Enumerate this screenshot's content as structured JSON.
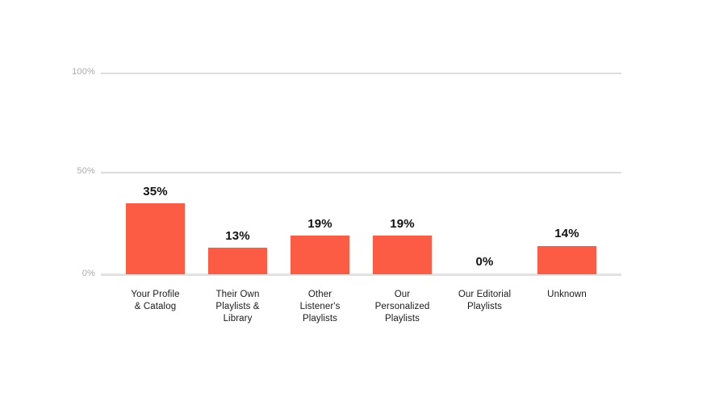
{
  "chart_data": {
    "type": "bar",
    "title": "",
    "subtitle": "",
    "xlabel": "",
    "ylabel": "",
    "categories": [
      "Your Profile\n& Catalog",
      "Their Own\nPlaylists &\nLibrary",
      "Other\nListener's\nPlaylists",
      "Our\nPersonalized\nPlaylists",
      "Our Editorial\nPlaylists",
      "Unknown"
    ],
    "values": [
      35,
      13,
      19,
      19,
      0,
      14
    ],
    "value_labels": [
      "35%",
      "13%",
      "19%",
      "19%",
      "0%",
      "14%"
    ],
    "ylim": [
      0,
      100
    ],
    "yticks": [
      0,
      50,
      100
    ],
    "ytick_labels": [
      "0%",
      "50%",
      "100%"
    ],
    "grid": true,
    "legend": false,
    "legend_position": "none",
    "bar_color": "#fc5c44",
    "gridline_color": "#dcdcdc",
    "axis_label_color": "#aaaaaa",
    "value_label_color": "#111111",
    "background_color": "#ffffff"
  },
  "axis": {
    "y": {
      "tick_0": "0%",
      "tick_50": "50%",
      "tick_100": "100%"
    }
  },
  "bars": [
    {
      "label_line1": "Your Profile",
      "label_line2": "& Catalog",
      "label_line3": "",
      "value": "35%"
    },
    {
      "label_line1": "Their Own",
      "label_line2": "Playlists &",
      "label_line3": "Library",
      "value": "13%"
    },
    {
      "label_line1": "Other",
      "label_line2": "Listener's",
      "label_line3": "Playlists",
      "value": "19%"
    },
    {
      "label_line1": "Our",
      "label_line2": "Personalized",
      "label_line3": "Playlists",
      "value": "19%"
    },
    {
      "label_line1": "Our Editorial",
      "label_line2": "Playlists",
      "label_line3": "",
      "value": "0%"
    },
    {
      "label_line1": "Unknown",
      "label_line2": "",
      "label_line3": "",
      "value": "14%"
    }
  ]
}
